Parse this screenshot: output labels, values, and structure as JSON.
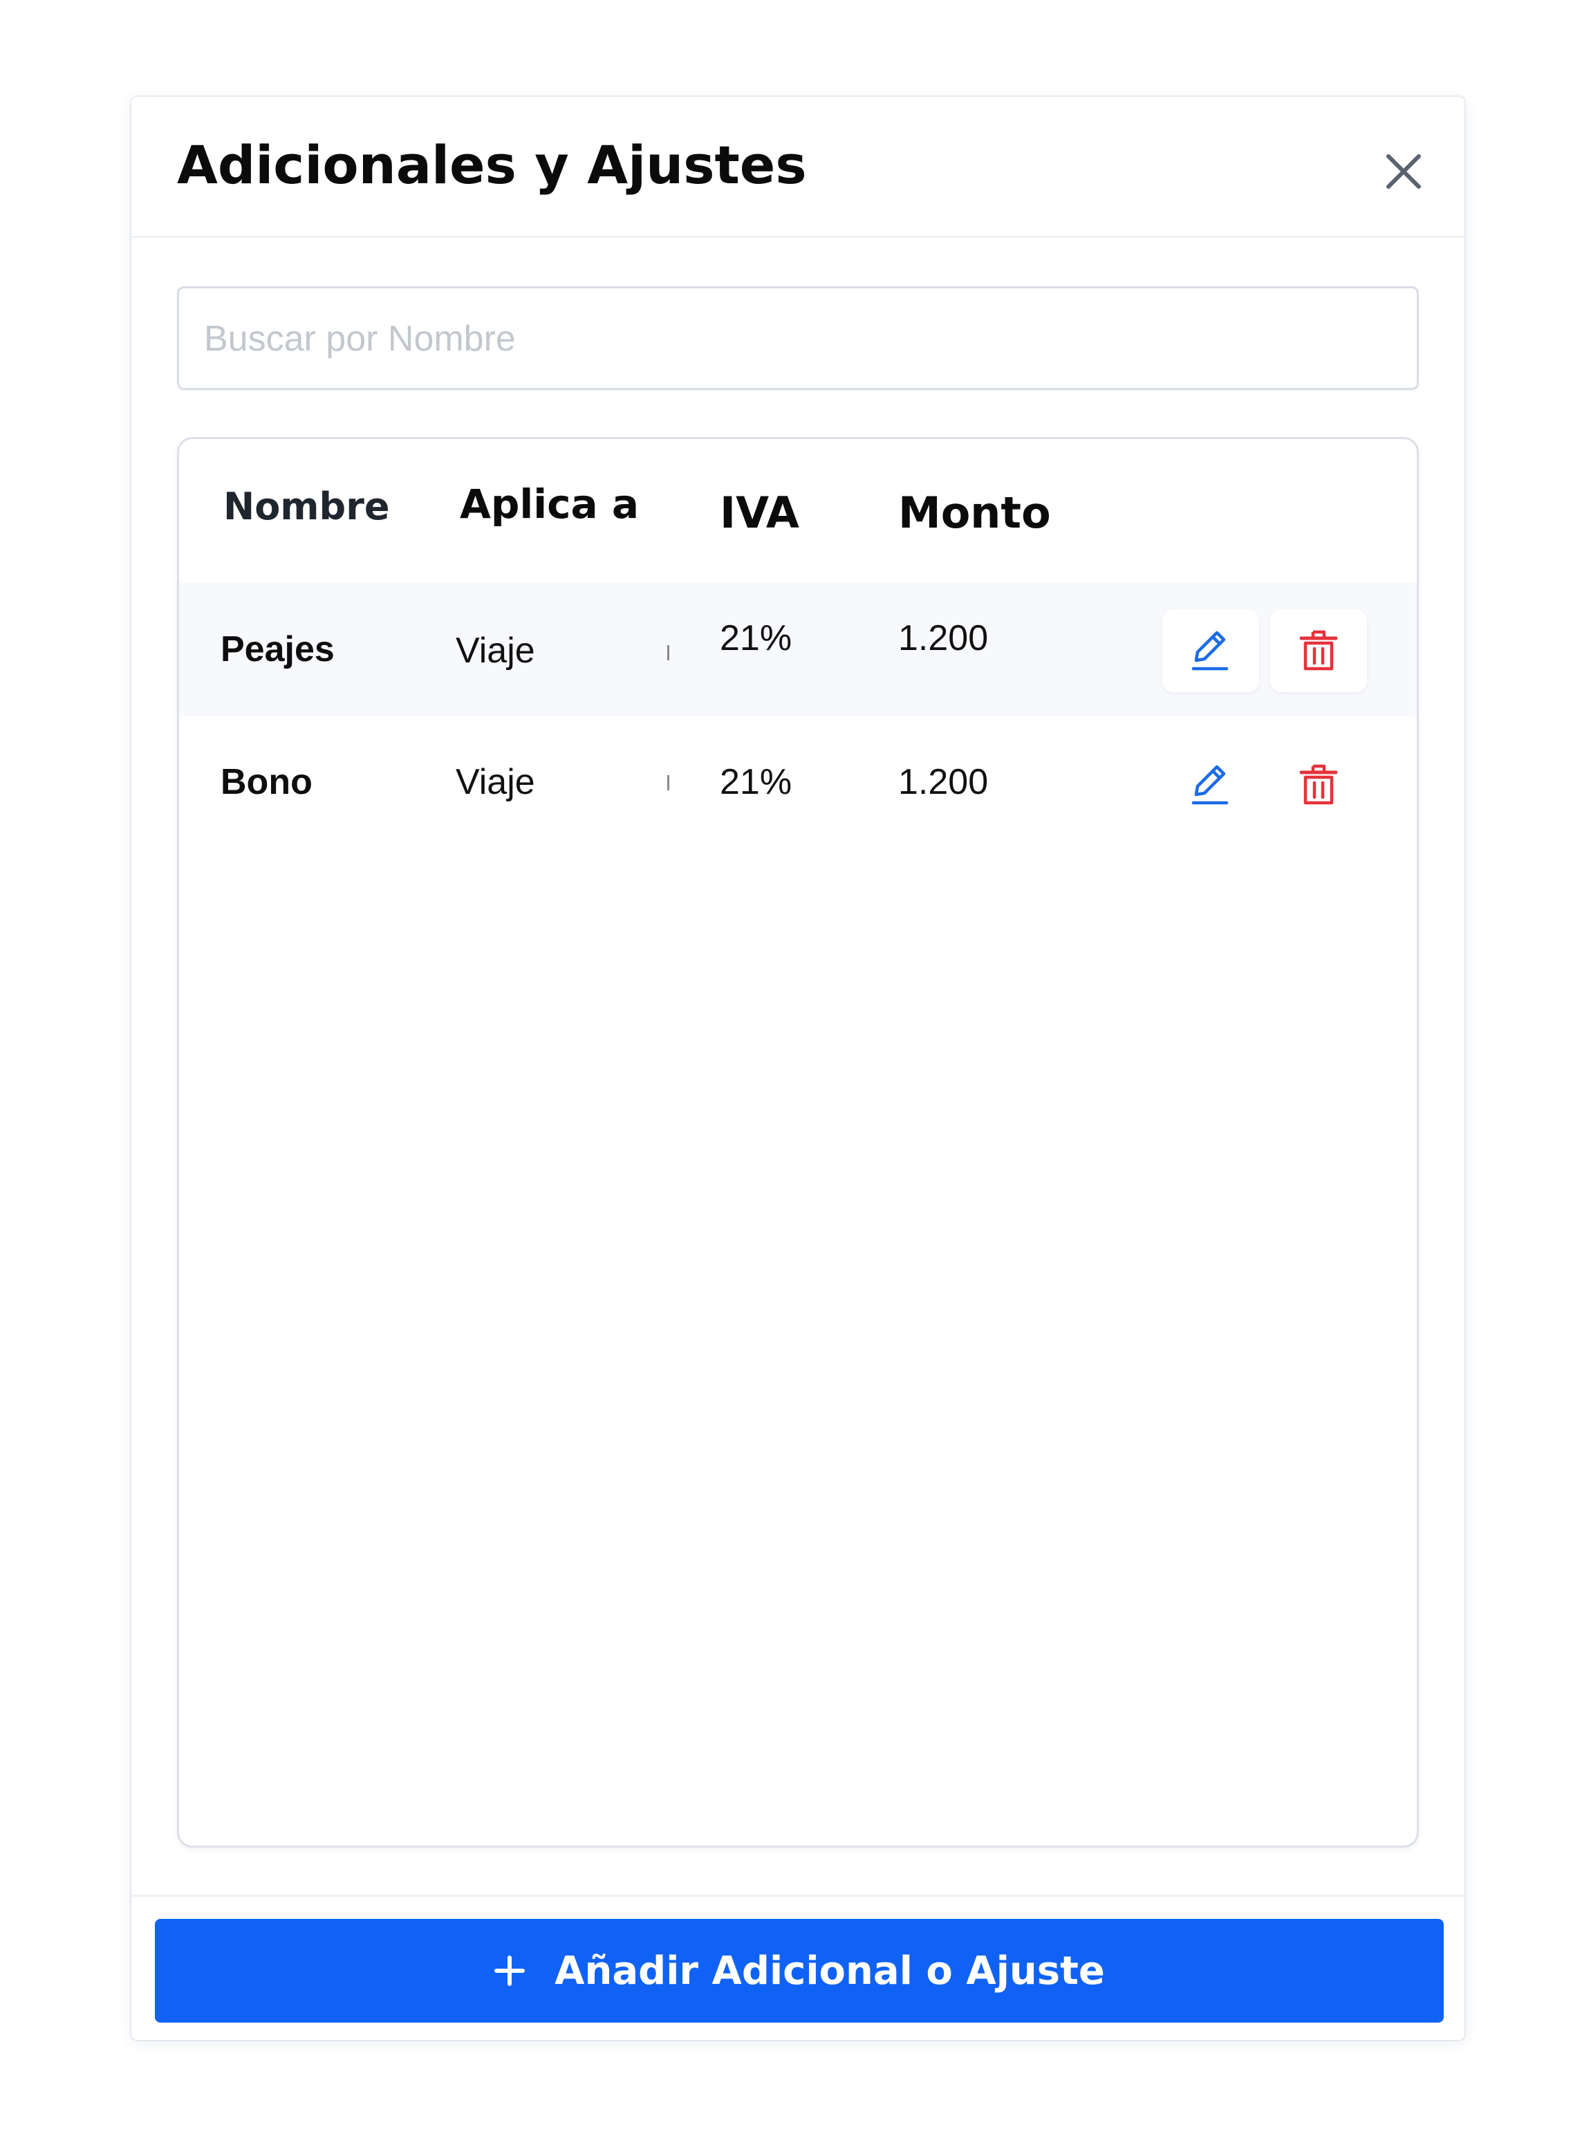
{
  "modal": {
    "title": "Adicionales y Ajustes"
  },
  "search": {
    "placeholder": "Buscar por Nombre",
    "value": ""
  },
  "table": {
    "headers": {
      "name": "Nombre",
      "applies_to": "Aplica a",
      "iva": "IVA",
      "amount": "Monto"
    },
    "rows": [
      {
        "name": "Peajes",
        "applies_to": "Viaje",
        "iva": "21%",
        "amount": "1.200"
      },
      {
        "name": "Bono",
        "applies_to": "Viaje",
        "iva": "21%",
        "amount": "1.200"
      }
    ]
  },
  "footer": {
    "add_label": "Añadir Adicional o Ajuste"
  },
  "icons": {
    "close": "close-icon",
    "edit": "pencil-icon",
    "delete": "trash-icon",
    "add": "plus-icon"
  },
  "colors": {
    "primary": "#1062f4",
    "edit": "#1a6be8",
    "delete": "#e5323b",
    "close": "#5b6270"
  }
}
